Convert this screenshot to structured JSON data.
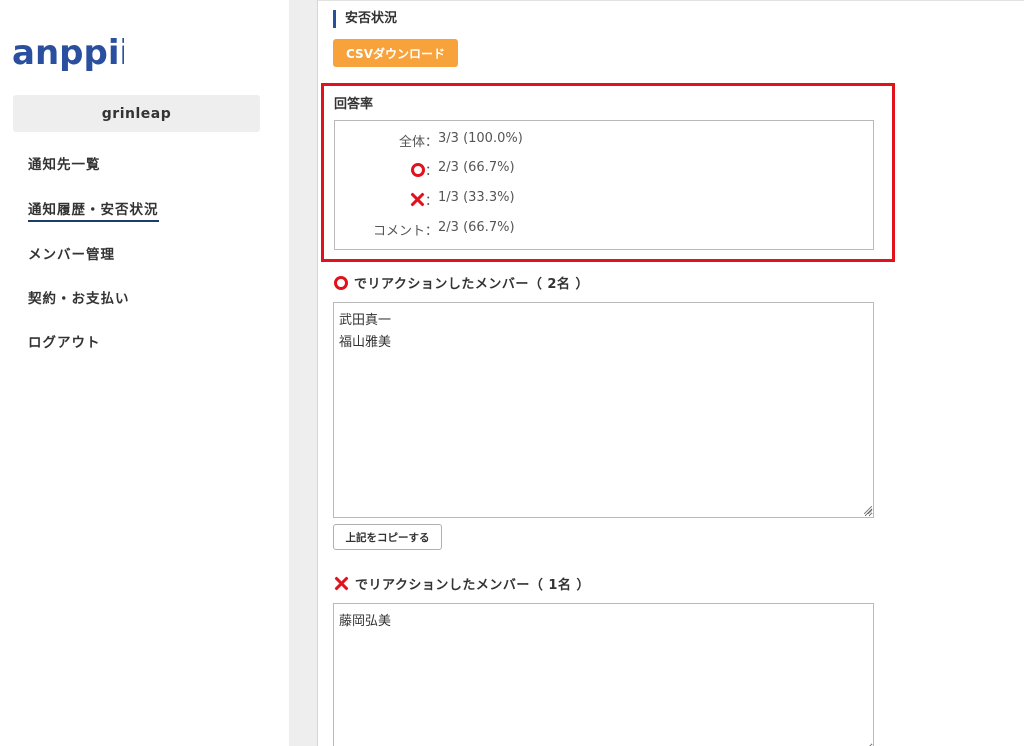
{
  "app": {
    "logo_text": "anppii",
    "brand_color": "#2b4f9f"
  },
  "sidebar": {
    "org_name": "grinleap",
    "items": [
      {
        "label": "通知先一覧",
        "active": false
      },
      {
        "label": "通知履歴・安否状況",
        "active": true
      },
      {
        "label": "メンバー管理",
        "active": false
      },
      {
        "label": "契約・お支払い",
        "active": false
      },
      {
        "label": "ログアウト",
        "active": false
      }
    ]
  },
  "main": {
    "section_title": "安否状況",
    "csv_button": "CSVダウンロード",
    "rate": {
      "title": "回答率",
      "rows": [
        {
          "label": "全体",
          "sep": "：",
          "value": "3/3 (100.0%)"
        },
        {
          "icon": "circle-icon",
          "sep": "：",
          "value": "2/3 (66.7%)"
        },
        {
          "icon": "cross-icon",
          "sep": "：",
          "value": "1/3 (33.3%)"
        },
        {
          "label": "コメント",
          "sep": "：",
          "value": "2/3 (66.7%)"
        }
      ]
    },
    "circle_members": {
      "title": "でリアクションしたメンバー（ 2名 ）",
      "names": "武田真一\n福山雅美",
      "copy_button": "上記をコピーする"
    },
    "cross_members": {
      "title": "でリアクションしたメンバー（ 1名 ）",
      "names": "藤岡弘美"
    }
  },
  "colors": {
    "accent": "#f7a23a",
    "highlight": "#e2121d",
    "nav_underline": "#1c3b6e"
  }
}
